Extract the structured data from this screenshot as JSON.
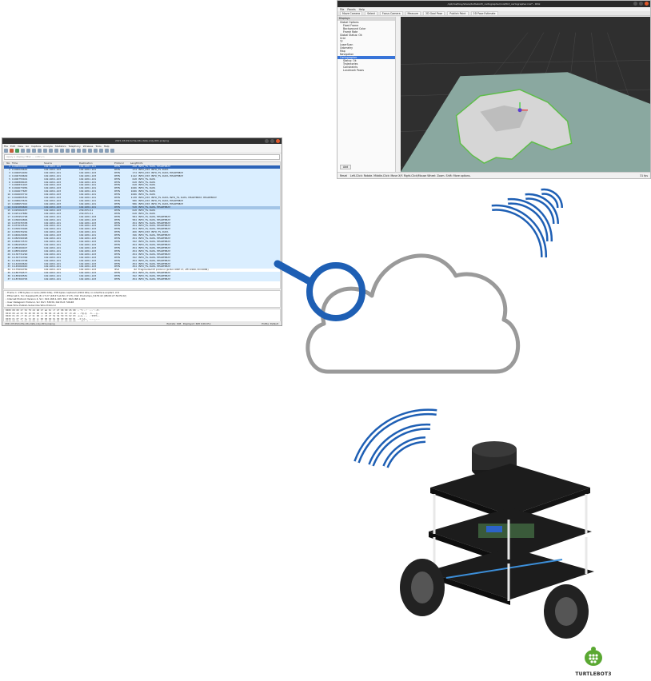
{
  "rviz": {
    "title": "/opt/ros/foxy/share/turtlebot3_cartographer/rviz/tb3_cartographer.rviz* - RViz",
    "menu": [
      "File",
      "Panels",
      "Help"
    ],
    "toolbar": [
      "Move Camera",
      "Select",
      "Focus Camera",
      "Measure",
      "2D Goal Pose",
      "Publish Point",
      "2D Pose Estimate"
    ],
    "displays_panel_title": "Displays",
    "displays_tree": [
      {
        "label": "Global Options",
        "indent": 0
      },
      {
        "label": "Fixed Frame",
        "indent": 1
      },
      {
        "label": "Background Color",
        "indent": 1
      },
      {
        "label": "Frame Rate",
        "indent": 1
      },
      {
        "label": "Global Status: Ok",
        "indent": 0
      },
      {
        "label": "Grid",
        "indent": 0
      },
      {
        "label": "TF",
        "indent": 0
      },
      {
        "label": "LaserScan",
        "indent": 0
      },
      {
        "label": "Odometry",
        "indent": 0
      },
      {
        "label": "Map",
        "indent": 0
      },
      {
        "label": "Navigation",
        "indent": 0
      },
      {
        "label": "Cartographer",
        "indent": 0,
        "selected": true
      },
      {
        "label": "Status: Ok",
        "indent": 1
      },
      {
        "label": "Trajectories",
        "indent": 1
      },
      {
        "label": "Constraints",
        "indent": 1
      },
      {
        "label": "Landmark Poses",
        "indent": 1
      }
    ],
    "add_label": "Add",
    "status": {
      "reset": "Reset",
      "hint": "Left-Click: Rotate. Middle-Click: Move X/Y. Right-Click/Mouse Wheel: Zoom. Shift: More options.",
      "fps": "31 fps"
    },
    "colors": {
      "background": "#2f2f2f",
      "map_floor": "#8aa8a0",
      "free_space": "#d4d4d4",
      "obstacle": "#5fbd4a",
      "grid": "#505050"
    }
  },
  "wireshark": {
    "title": "2021.03.09-turtle-dds-data-only-001.pcapng",
    "menu": [
      "File",
      "Edit",
      "View",
      "Go",
      "Capture",
      "Analyze",
      "Statistics",
      "Telephony",
      "Wireless",
      "Tools",
      "Help"
    ],
    "filter_placeholder": "Apply a display filter ... <Ctrl-/>",
    "columns": {
      "no": "No.",
      "time": "Time",
      "source": "Source",
      "destination": "Destination",
      "protocol": "Protocol",
      "length": "Length",
      "info": "Info"
    },
    "packets": [
      {
        "no": "1",
        "time": "0.000000000",
        "src": "192.168.1.103",
        "dst": "192.168.1.101",
        "proto": "RTPS",
        "len": "238",
        "info": "INFO_TS, DATA, HEARTBEAT",
        "style": "sel"
      },
      {
        "no": "2",
        "time": "0.000029644",
        "src": "192.168.1.103",
        "dst": "192.168.1.101",
        "proto": "RTPS",
        "len": "174",
        "info": "INFO_DST, INFO_TS, DATA",
        "style": "udp"
      },
      {
        "no": "3",
        "time": "0.000054049",
        "src": "192.168.1.101",
        "dst": "192.168.1.103",
        "proto": "RTPS",
        "len": "174",
        "info": "INFO_DST, INFO_TS, DATA, HEARTBEAT",
        "style": "udp"
      },
      {
        "no": "4",
        "time": "0.000709609",
        "src": "192.168.1.101",
        "dst": "192.168.1.103",
        "proto": "RTPS",
        "len": "1142",
        "info": "INFO_DST, INFO_TS, DATA, HEARTBEAT",
        "style": "udp"
      },
      {
        "no": "5",
        "time": "0.000755401",
        "src": "192.168.1.103",
        "dst": "192.168.1.101",
        "proto": "RTPS",
        "len": "618",
        "info": "INFO_TS, DATA",
        "style": "udp"
      },
      {
        "no": "6",
        "time": "0.000808425",
        "src": "192.168.1.103",
        "dst": "192.168.1.101",
        "proto": "RTPS",
        "len": "618",
        "info": "INFO_TS, DATA",
        "style": "udp"
      },
      {
        "no": "7",
        "time": "0.000831923",
        "src": "192.168.1.103",
        "dst": "192.168.1.101",
        "proto": "RTPS",
        "len": "618",
        "info": "INFO_TS, DATA",
        "style": "udp"
      },
      {
        "no": "8",
        "time": "0.004673956",
        "src": "192.168.1.103",
        "dst": "192.168.1.101",
        "proto": "RTPS",
        "len": "1066",
        "info": "INFO_TS, DATA",
        "style": "udp"
      },
      {
        "no": "9",
        "time": "0.004677687",
        "src": "192.168.1.103",
        "dst": "192.168.1.101",
        "proto": "RTPS",
        "len": "1066",
        "info": "INFO_TS, DATA",
        "style": "udp"
      },
      {
        "no": "10",
        "time": "0.004693719",
        "src": "192.168.1.103",
        "dst": "192.168.1.101",
        "proto": "RTPS",
        "len": "1066",
        "info": "INFO_TS, DATA",
        "style": "udp"
      },
      {
        "no": "11",
        "time": "0.004883530",
        "src": "192.168.1.103",
        "dst": "192.168.1.101",
        "proto": "RTPS",
        "len": "1138",
        "info": "INFO_DST, INFO_TS, DATA, INFO_TS, DATA, HEARTBEAT, HEARTBEAT",
        "style": "udp"
      },
      {
        "no": "12",
        "time": "0.008623634",
        "src": "192.168.1.103",
        "dst": "192.168.1.101",
        "proto": "RTPS",
        "len": "586",
        "info": "INFO_DST, INFO_TS, DATA, HEARTBEAT",
        "style": "udp"
      },
      {
        "no": "13",
        "time": "0.008657022",
        "src": "192.168.1.103",
        "dst": "192.168.1.101",
        "proto": "RTPS",
        "len": "586",
        "info": "INFO_DST, INFO_TS, DATA, HEARTBEAT",
        "style": "udp"
      },
      {
        "no": "14",
        "time": "0.021084600",
        "src": "192.168.1.103",
        "dst": "192.168.1.101",
        "proto": "RTPS",
        "len": "518",
        "info": "INFO_TS, DATA, HEARTBEAT",
        "style": "alt"
      },
      {
        "no": "15",
        "time": "0.025062437",
        "src": "192.168.1.103",
        "dst": "239.255.0.1",
        "proto": "RTPS",
        "len": "618",
        "info": "INFO_TS, DATA",
        "style": "udp"
      },
      {
        "no": "16",
        "time": "0.025147880",
        "src": "192.168.1.103",
        "dst": "239.255.0.1",
        "proto": "RTPS",
        "len": "618",
        "info": "INFO_TS, DATA",
        "style": "udp"
      },
      {
        "no": "17",
        "time": "0.035952798",
        "src": "192.168.1.101",
        "dst": "192.168.1.103",
        "proto": "RTPS",
        "len": "584",
        "info": "INFO_TS, DATA, HEARTBEAT",
        "style": "udp"
      },
      {
        "no": "18",
        "time": "0.036094806",
        "src": "192.168.1.101",
        "dst": "192.168.1.103",
        "proto": "RTPS",
        "len": "584",
        "info": "INFO_TS, DATA, HEARTBEAT",
        "style": "udp"
      },
      {
        "no": "19",
        "time": "0.037035338",
        "src": "192.168.1.101",
        "dst": "192.168.1.103",
        "proto": "RTPS",
        "len": "454",
        "info": "INFO_TS, DATA, HEARTBEAT",
        "style": "udp"
      },
      {
        "no": "20",
        "time": "0.037632516",
        "src": "192.168.1.101",
        "dst": "192.168.1.103",
        "proto": "RTPS",
        "len": "454",
        "info": "INFO_TS, DATA, HEARTBEAT",
        "style": "udp"
      },
      {
        "no": "21",
        "time": "0.039533048",
        "src": "192.168.1.101",
        "dst": "192.168.1.103",
        "proto": "RTPS",
        "len": "454",
        "info": "INFO_TS, DATA, HEARTBEAT",
        "style": "udp"
      },
      {
        "no": "22",
        "time": "0.039535264",
        "src": "192.168.1.103",
        "dst": "192.168.1.101",
        "proto": "RTPS",
        "len": "406",
        "info": "INFO_DST, INFO_TS, DATA",
        "style": "udp"
      },
      {
        "no": "23",
        "time": "0.040620465",
        "src": "192.168.1.103",
        "dst": "192.168.1.101",
        "proto": "RTPS",
        "len": "346",
        "info": "INFO_TS, DATA, HEARTBEAT",
        "style": "udp"
      },
      {
        "no": "24",
        "time": "0.082590498",
        "src": "192.168.1.101",
        "dst": "192.168.1.103",
        "proto": "RTPS",
        "len": "454",
        "info": "INFO_TS, DATA, HEARTBEAT",
        "style": "udp"
      },
      {
        "no": "25",
        "time": "0.083072570",
        "src": "192.168.1.101",
        "dst": "192.168.1.103",
        "proto": "RTPS",
        "len": "342",
        "info": "INFO_TS, DATA, HEARTBEAT",
        "style": "udp"
      },
      {
        "no": "26",
        "time": "0.084456507",
        "src": "192.168.1.101",
        "dst": "192.168.1.103",
        "proto": "RTPS",
        "len": "454",
        "info": "INFO_TS, DATA, HEARTBEAT",
        "style": "udp"
      },
      {
        "no": "27",
        "time": "0.085469407",
        "src": "192.168.1.101",
        "dst": "192.168.1.103",
        "proto": "RTPS",
        "len": "454",
        "info": "INFO_TS, DATA, HEARTBEAT",
        "style": "udp"
      },
      {
        "no": "28",
        "time": "0.085540993",
        "src": "192.168.1.101",
        "dst": "192.168.1.103",
        "proto": "RTPS",
        "len": "454",
        "info": "INFO_TS, DATA, HEARTBEAT",
        "style": "udp"
      },
      {
        "no": "29",
        "time": "0.130731290",
        "src": "192.168.1.101",
        "dst": "192.168.1.103",
        "proto": "RTPS",
        "len": "454",
        "info": "INFO_TS, DATA, HEARTBEAT",
        "style": "udp"
      },
      {
        "no": "30",
        "time": "0.130732399",
        "src": "192.168.1.101",
        "dst": "192.168.1.103",
        "proto": "RTPS",
        "len": "342",
        "info": "INFO_TS, DATA, HEARTBEAT",
        "style": "udp"
      },
      {
        "no": "31",
        "time": "0.130913708",
        "src": "192.168.1.101",
        "dst": "192.168.1.103",
        "proto": "RTPS",
        "len": "454",
        "info": "INFO_TS, DATA, HEARTBEAT",
        "style": "udp"
      },
      {
        "no": "32",
        "time": "0.142069649",
        "src": "192.168.1.101",
        "dst": "192.168.1.103",
        "proto": "RTPS",
        "len": "454",
        "info": "INFO_TS, DATA, HEARTBEAT",
        "style": "udp"
      },
      {
        "no": "33",
        "time": "0.145060020",
        "src": "192.168.1.101",
        "dst": "192.168.1.103",
        "proto": "RTPS",
        "len": "454",
        "info": "INFO_TS, DATA, HEARTBEAT",
        "style": "udp"
      },
      {
        "no": "34",
        "time": "0.175694784",
        "src": "192.168.1.101",
        "dst": "192.168.1.103",
        "proto": "IPv4",
        "len": "62",
        "info": "Fragmented IP protocol (proto=UDP 17, off=1960, ID=0084)",
        "style": "frag"
      },
      {
        "no": "35",
        "time": "0.185756577",
        "src": "192.168.1.101",
        "dst": "192.168.1.103",
        "proto": "RTPS",
        "len": "454",
        "info": "INFO_TS, DATA, HEARTBEAT",
        "style": "udp"
      },
      {
        "no": "36",
        "time": "0.185999581",
        "src": "192.168.1.101",
        "dst": "192.168.1.103",
        "proto": "RTPS",
        "len": "342",
        "info": "INFO_TS, DATA, HEARTBEAT",
        "style": "udp"
      },
      {
        "no": "37",
        "time": "0.187300705",
        "src": "192.168.1.101",
        "dst": "192.168.1.103",
        "proto": "RTPS",
        "len": "454",
        "info": "INFO_TS, DATA, HEARTBEAT",
        "style": "udp"
      }
    ],
    "details": [
      "› Frame 1: 238 bytes on wire (1904 bits), 238 bytes captured (1904 bits) on interface enp0s3, id 0",
      "› Ethernet II, Src: RaspberrPi_8c:c7:27 (b8:27:eb:8c:c7:27), Dst: PcsCompu_54:f9:d2 (08:00:27:54:f9:d2)",
      "› Internet Protocol Version 4, Src: 192.168.1.103, Dst: 192.168.1.101",
      "› User Datagram Protocol, Src Port: 53030, Dst Port: 59148",
      "› Real-Time Publish-Subscribe Wire Protocol"
    ],
    "bytes": [
      "0000  08 00 27 54 f9 d2 b8 27  eb 8c c7 27 08 00 45 00   ··'T···' ···'··E·",
      "0010  00 e0 2d 59 40 00 40 11  89 68 c0 a8 01 67 c0 a8   ··-Y@·@· ·h···g··",
      "0020  01 65 cf 26 e7 0c 00 cc  d3 27 52 54 50 53 02 03   ·e·&···· ·'RTPS··",
      "0030  01 0f 4f 3a 7d 40 1c 00  00 00 01 00 00 00 09 01   ··O:}@·· ········",
      "0040  08 00 a3 6d 47 60 0e 4a  fd 0b 15 05 7c 00 00 00   ···mG`·J ····|···"
    ],
    "status": {
      "file": "2021.03.09-turtle-dds-data-only-001.pcapng",
      "packets": "Packets: 608 · Displayed: 608 (100.0%)",
      "profile": "Profile: Default"
    }
  },
  "logo": {
    "text": "TURTLEBOT3"
  },
  "colors": {
    "accent_blue": "#1e5fb4",
    "cloud_gray": "#9a9a9a",
    "wifi_blue": "#1e5fb4",
    "logo_green": "#5aa832"
  }
}
